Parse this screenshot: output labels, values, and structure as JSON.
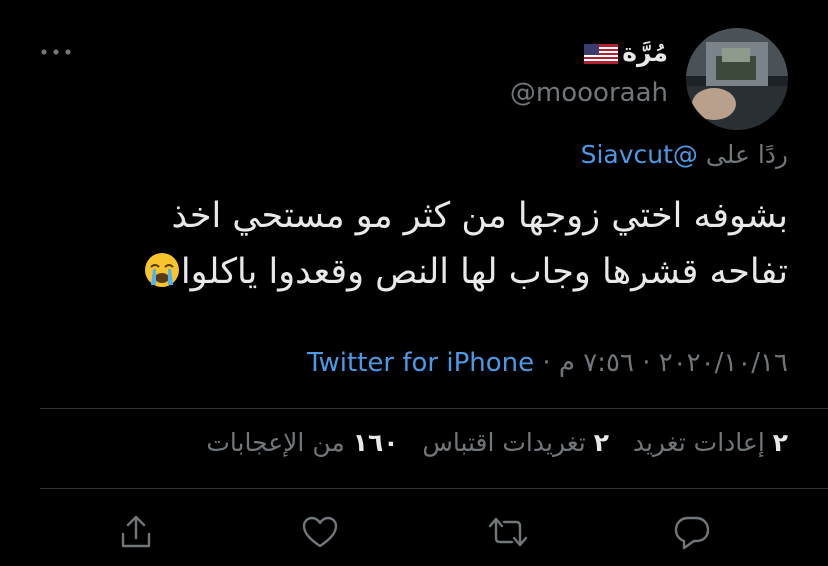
{
  "author": {
    "display_name": "مُرَّة",
    "handle": "@moooraah"
  },
  "reply": {
    "prefix": "ردًا على",
    "mention": "@Siavcut"
  },
  "tweet": {
    "line1": "بشوفه اختي زوجها من كثر مو مستحي اخذ",
    "line2": "تفاحه قشرها وجاب لها النص وقعدوا ياكلوا"
  },
  "meta": {
    "date": "٢٠٢٠/١٠/١٦",
    "time": "٧:٥٦ م",
    "separator": "·",
    "source": "Twitter for iPhone"
  },
  "stats": {
    "retweets_count": "٢",
    "retweets_label": "إعادات تغريد",
    "quotes_count": "٢",
    "quotes_label": "تغريدات اقتباس",
    "likes_count": "١٦٠",
    "likes_label": "من الإعجابات"
  },
  "icons": {
    "more": "more-horizontal-icon",
    "flag": "us-flag-icon",
    "emoji": "loudly-crying-face-icon",
    "reply": "comment-icon",
    "retweet": "retweet-icon",
    "like": "heart-icon",
    "share": "share-icon"
  },
  "colors": {
    "background": "#000000",
    "text": "#e7e9ea",
    "secondary": "#71767b",
    "link": "#4c9ae6",
    "divider": "#2f3336"
  }
}
